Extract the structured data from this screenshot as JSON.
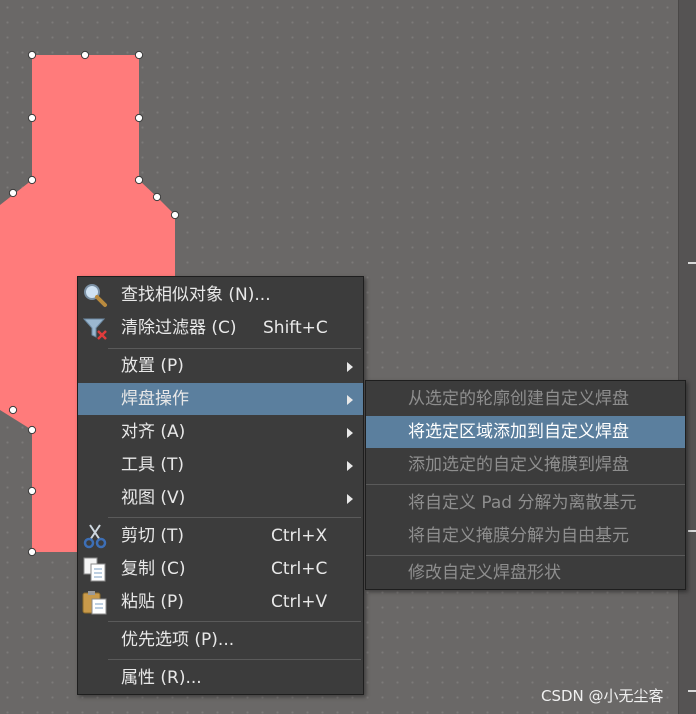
{
  "context_menu": {
    "items": [
      {
        "label": "查找相似对象 (N)...",
        "shortcut": "",
        "icon": "magnifier-icon",
        "submenu": false
      },
      {
        "label": "清除过滤器 (C)",
        "shortcut": "Shift+C",
        "icon": "clear-filter-icon",
        "submenu": false
      },
      {
        "label": "放置 (P)",
        "shortcut": "",
        "submenu": true
      },
      {
        "label": "焊盘操作",
        "shortcut": "",
        "submenu": true,
        "highlighted": true
      },
      {
        "label": "对齐 (A)",
        "shortcut": "",
        "submenu": true
      },
      {
        "label": "工具 (T)",
        "shortcut": "",
        "submenu": true
      },
      {
        "label": "视图 (V)",
        "shortcut": "",
        "submenu": true
      },
      {
        "label": "剪切 (T)",
        "shortcut": "Ctrl+X",
        "icon": "scissors-icon",
        "submenu": false
      },
      {
        "label": "复制 (C)",
        "shortcut": "Ctrl+C",
        "icon": "copy-icon",
        "submenu": false
      },
      {
        "label": "粘贴 (P)",
        "shortcut": "Ctrl+V",
        "icon": "paste-icon",
        "submenu": false
      },
      {
        "label": "优先选项 (P)...",
        "shortcut": "",
        "submenu": false
      },
      {
        "label": "属性 (R)...",
        "shortcut": "",
        "submenu": false
      }
    ]
  },
  "pad_submenu": {
    "items": [
      {
        "label": "从选定的轮廓创建自定义焊盘",
        "enabled": false
      },
      {
        "label": "将选定区域添加到自定义焊盘",
        "enabled": true,
        "highlighted": true
      },
      {
        "label": "添加选定的自定义掩膜到焊盘",
        "enabled": false
      },
      {
        "label": "将自定义 Pad 分解为离散基元",
        "enabled": false
      },
      {
        "label": "将自定义掩膜分解为自由基元",
        "enabled": false
      },
      {
        "label": "修改自定义焊盘形状",
        "enabled": false
      }
    ]
  },
  "watermark": "CSDN @小无尘客",
  "colors": {
    "canvas": "#6a6867",
    "shape_fill": "#ff7b7b",
    "menu_bg": "#3c3c3c",
    "highlight": "#5b7f9e"
  }
}
